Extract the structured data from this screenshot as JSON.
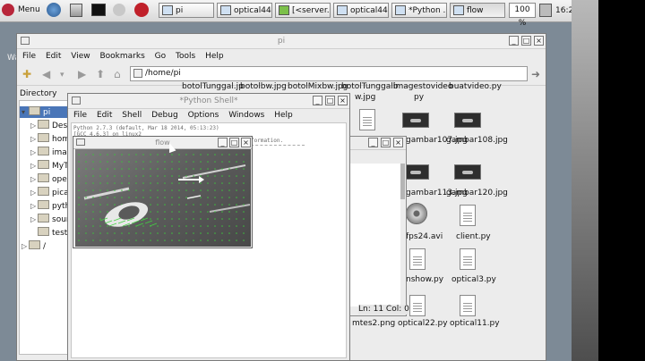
{
  "taskbar": {
    "menu_label": "Menu",
    "buttons": [
      "pi",
      "optical44...",
      "[<server.p...",
      "optical44...",
      "*Python ...",
      "flow"
    ],
    "zoom": "100 %",
    "clock": "16:2"
  },
  "desktop": {
    "partial_label": "Wa"
  },
  "file_manager": {
    "title": "pi",
    "menu": [
      "File",
      "Edit",
      "View",
      "Bookmarks",
      "Go",
      "Tools",
      "Help"
    ],
    "address": "/home/pi",
    "tree_header": "Directory Tree",
    "tree": [
      {
        "label": "pi",
        "selected": true
      },
      {
        "label": "Desk"
      },
      {
        "label": "homo"
      },
      {
        "label": "imag"
      },
      {
        "label": "MyTe"
      },
      {
        "label": "openc"
      },
      {
        "label": "picam"
      },
      {
        "label": "pytho"
      },
      {
        "label": "sourc"
      },
      {
        "label": "test"
      },
      {
        "label": "/"
      }
    ],
    "files": {
      "row0": [
        "botolTunggal.jp",
        "botolbw.jpg",
        "botolMixbw.jpg",
        "botolTunggalb",
        "imagestovideo",
        "buatvideo.py"
      ],
      "row0b": [
        "w.jpg",
        "py"
      ],
      "row1": [
        "gambar107.jpg",
        "gambar108.jpg"
      ],
      "row2": [
        "gambar113.jpg",
        "gambar120.jpg"
      ],
      "row3": [
        "fps24.avi",
        "client.py"
      ],
      "row4": [
        "nshow.py",
        "optical3.py"
      ],
      "row5": [
        "mtes2.png",
        "optical22.py",
        "optical11.py"
      ]
    },
    "editor_status": "Ln: 11 Col: 0"
  },
  "python_shell": {
    "title": "*Python Shell*",
    "menu": [
      "File",
      "Edit",
      "Shell",
      "Debug",
      "Options",
      "Windows",
      "Help"
    ],
    "lines": [
      "Python 2.7.3 (default, Mar 18 2014, 05:13:23)",
      "[GCC 4.6.3] on linux2",
      "formation."
    ]
  },
  "flow_window": {
    "title": "flow"
  }
}
